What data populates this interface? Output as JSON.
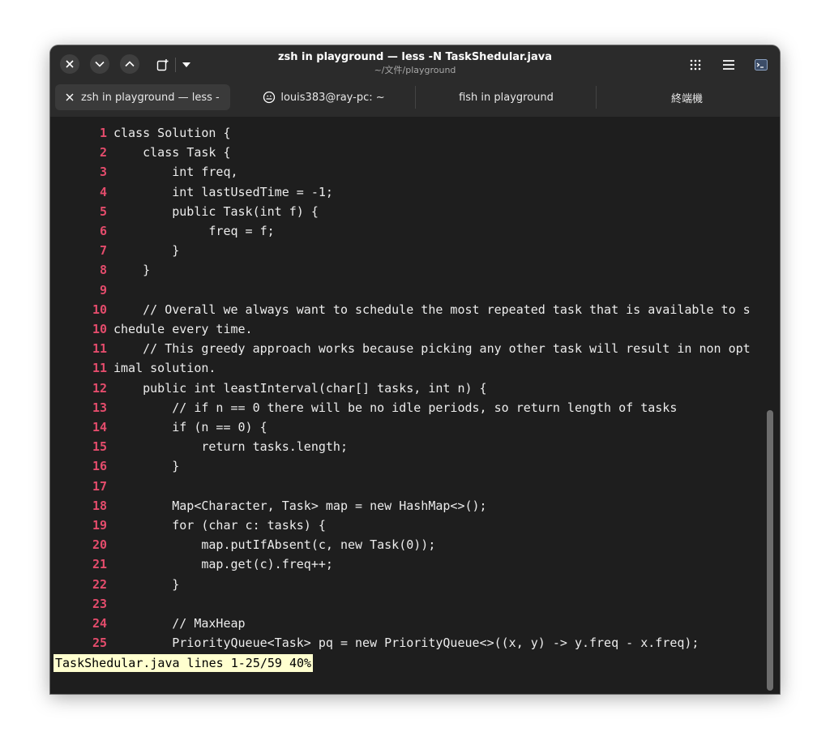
{
  "window": {
    "title": "zsh in playground — less -N TaskShedular.java",
    "subtitle": "~/文件/playground"
  },
  "tabs": [
    {
      "label": "zsh in playground — less -N TaskShedular.java",
      "active": true
    },
    {
      "label": "louis383@ray-pc: ~",
      "active": false
    },
    {
      "label": "fish in playground",
      "active": false
    },
    {
      "label": "終端機",
      "active": false
    }
  ],
  "lines": [
    {
      "n": "1",
      "t": "class Solution {"
    },
    {
      "n": "2",
      "t": "    class Task {"
    },
    {
      "n": "3",
      "t": "        int freq,"
    },
    {
      "n": "4",
      "t": "        int lastUsedTime = -1;"
    },
    {
      "n": "5",
      "t": "        public Task(int f) {"
    },
    {
      "n": "6",
      "t": "             freq = f;"
    },
    {
      "n": "7",
      "t": "        }"
    },
    {
      "n": "8",
      "t": "    }"
    },
    {
      "n": "9",
      "t": ""
    },
    {
      "n": "10",
      "t": "    // Overall we always want to schedule the most repeated task that is available to s"
    },
    {
      "n": "10",
      "t": "chedule every time."
    },
    {
      "n": "11",
      "t": "    // This greedy approach works because picking any other task will result in non opt"
    },
    {
      "n": "11",
      "t": "imal solution."
    },
    {
      "n": "12",
      "t": "    public int leastInterval(char[] tasks, int n) {"
    },
    {
      "n": "13",
      "t": "        // if n == 0 there will be no idle periods, so return length of tasks"
    },
    {
      "n": "14",
      "t": "        if (n == 0) {"
    },
    {
      "n": "15",
      "t": "            return tasks.length;"
    },
    {
      "n": "16",
      "t": "        }"
    },
    {
      "n": "17",
      "t": ""
    },
    {
      "n": "18",
      "t": "        Map<Character, Task> map = new HashMap<>();"
    },
    {
      "n": "19",
      "t": "        for (char c: tasks) {"
    },
    {
      "n": "20",
      "t": "            map.putIfAbsent(c, new Task(0));"
    },
    {
      "n": "21",
      "t": "            map.get(c).freq++;"
    },
    {
      "n": "22",
      "t": "        }"
    },
    {
      "n": "23",
      "t": ""
    },
    {
      "n": "24",
      "t": "        // MaxHeap"
    },
    {
      "n": "25",
      "t": "        PriorityQueue<Task> pq = new PriorityQueue<>((x, y) -> y.freq - x.freq);"
    }
  ],
  "status": "TaskShedular.java lines 1-25/59 40%",
  "colors": {
    "background": "#1e1e1e",
    "line_number": "#e44c6c",
    "text": "#ececec",
    "status_bg": "#ffffcf"
  }
}
